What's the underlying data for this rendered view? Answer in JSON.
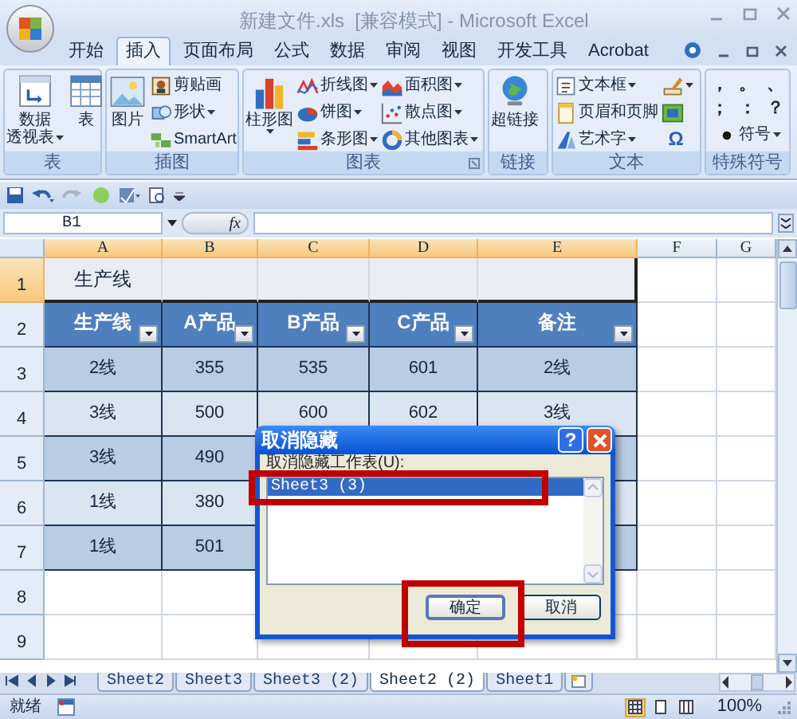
{
  "window": {
    "title": "新建文件.xls  [兼容模式] - Microsoft Excel"
  },
  "ribbon_tabs": [
    {
      "label": "开始",
      "selected": false
    },
    {
      "label": "插入",
      "selected": true
    },
    {
      "label": "页面布局",
      "selected": false
    },
    {
      "label": "公式",
      "selected": false
    },
    {
      "label": "数据",
      "selected": false
    },
    {
      "label": "审阅",
      "selected": false
    },
    {
      "label": "视图",
      "selected": false
    },
    {
      "label": "开发工具",
      "selected": false
    },
    {
      "label": "Acrobat",
      "selected": false
    }
  ],
  "ribbon_groups": [
    {
      "label": "表",
      "items": [
        {
          "kind": "large",
          "lines": [
            "数据",
            "透视表"
          ],
          "dropdown": true
        },
        {
          "kind": "large",
          "lines": [
            "表"
          ],
          "dropdown": false
        }
      ]
    },
    {
      "label": "插图",
      "items": [
        {
          "kind": "large",
          "lines": [
            "图片"
          ],
          "dropdown": false
        },
        {
          "kind": "small",
          "label": "剪贴画",
          "dropdown": false
        },
        {
          "kind": "small",
          "label": "形状",
          "dropdown": true
        },
        {
          "kind": "small",
          "label": "SmartArt",
          "dropdown": false
        }
      ]
    },
    {
      "label": "图表",
      "launcher": true,
      "items": [
        {
          "kind": "large",
          "lines": [
            "柱形图"
          ],
          "dropdown": true
        },
        {
          "kind": "small",
          "label": "折线图",
          "dropdown": true
        },
        {
          "kind": "small",
          "label": "饼图",
          "dropdown": true
        },
        {
          "kind": "small",
          "label": "条形图",
          "dropdown": true
        },
        {
          "kind": "small",
          "label": "面积图",
          "dropdown": true
        },
        {
          "kind": "small",
          "label": "散点图",
          "dropdown": true
        },
        {
          "kind": "small",
          "label": "其他图表",
          "dropdown": true
        }
      ]
    },
    {
      "label": "链接",
      "items": [
        {
          "kind": "large",
          "lines": [
            "超链接"
          ],
          "dropdown": false
        }
      ]
    },
    {
      "label": "文本",
      "items": [
        {
          "kind": "small",
          "label": "文本框",
          "dropdown": true
        },
        {
          "kind": "small",
          "label": "页眉和页脚",
          "dropdown": false
        },
        {
          "kind": "small",
          "label": "艺术字",
          "dropdown": true
        },
        {
          "kind": "icon_only",
          "dropdown": true
        },
        {
          "kind": "icon_only",
          "dropdown": false
        },
        {
          "kind": "glyph",
          "label": "Ω",
          "dropdown": false
        }
      ]
    },
    {
      "label": "特殊符号",
      "items": [
        {
          "kind": "symbol",
          "label": "，"
        },
        {
          "kind": "symbol",
          "label": "。"
        },
        {
          "kind": "symbol",
          "label": "、"
        },
        {
          "kind": "symbol",
          "label": "；"
        },
        {
          "kind": "symbol",
          "label": "："
        },
        {
          "kind": "symbol",
          "label": "？"
        },
        {
          "kind": "small",
          "label": "符号",
          "dropdown": true
        }
      ]
    }
  ],
  "formula_bar": {
    "name_box": "B1",
    "function_label": "fx"
  },
  "column_headers": [
    {
      "label": "A",
      "selected": true
    },
    {
      "label": "B",
      "selected": true
    },
    {
      "label": "C",
      "selected": true
    },
    {
      "label": "D",
      "selected": true
    },
    {
      "label": "E",
      "selected": true
    },
    {
      "label": "F",
      "selected": false
    },
    {
      "label": "G",
      "selected": false
    }
  ],
  "row_headers": [
    {
      "label": "1",
      "selected": true
    },
    {
      "label": "2",
      "selected": false
    },
    {
      "label": "3",
      "selected": false
    },
    {
      "label": "4",
      "selected": false
    },
    {
      "label": "5",
      "selected": false
    },
    {
      "label": "6",
      "selected": false
    },
    {
      "label": "7",
      "selected": false
    },
    {
      "label": "8",
      "selected": false
    },
    {
      "label": "9",
      "selected": false
    }
  ],
  "title_cell": "生产线",
  "table": {
    "columns": [
      "生产线",
      "A产品",
      "B产品",
      "C产品",
      "备注"
    ],
    "rows": [
      [
        "2线",
        "355",
        "535",
        "601",
        "2线"
      ],
      [
        "3线",
        "500",
        "600",
        "602",
        "3线"
      ],
      [
        "3线",
        "490"
      ],
      [
        "1线",
        "380"
      ],
      [
        "1线",
        "501"
      ]
    ]
  },
  "dialog": {
    "title": "取消隐藏",
    "help": "?",
    "label": "取消隐藏工作表(U):",
    "items": [
      {
        "label": "Sheet3 (3)",
        "selected": true
      }
    ],
    "buttons": [
      {
        "label": "确定",
        "default": true
      },
      {
        "label": "取消",
        "default": false
      }
    ]
  },
  "sheet_tabs": [
    {
      "label": "Sheet2",
      "selected": false
    },
    {
      "label": "Sheet3",
      "selected": false
    },
    {
      "label": "Sheet3 (2)",
      "selected": false
    },
    {
      "label": "Sheet2 (2)",
      "selected": true
    },
    {
      "label": "Sheet1",
      "selected": false
    }
  ],
  "status_bar": {
    "status": "就绪",
    "views": [
      {
        "selected": true
      },
      {
        "selected": false
      },
      {
        "selected": false
      }
    ],
    "zoom": "100%"
  }
}
